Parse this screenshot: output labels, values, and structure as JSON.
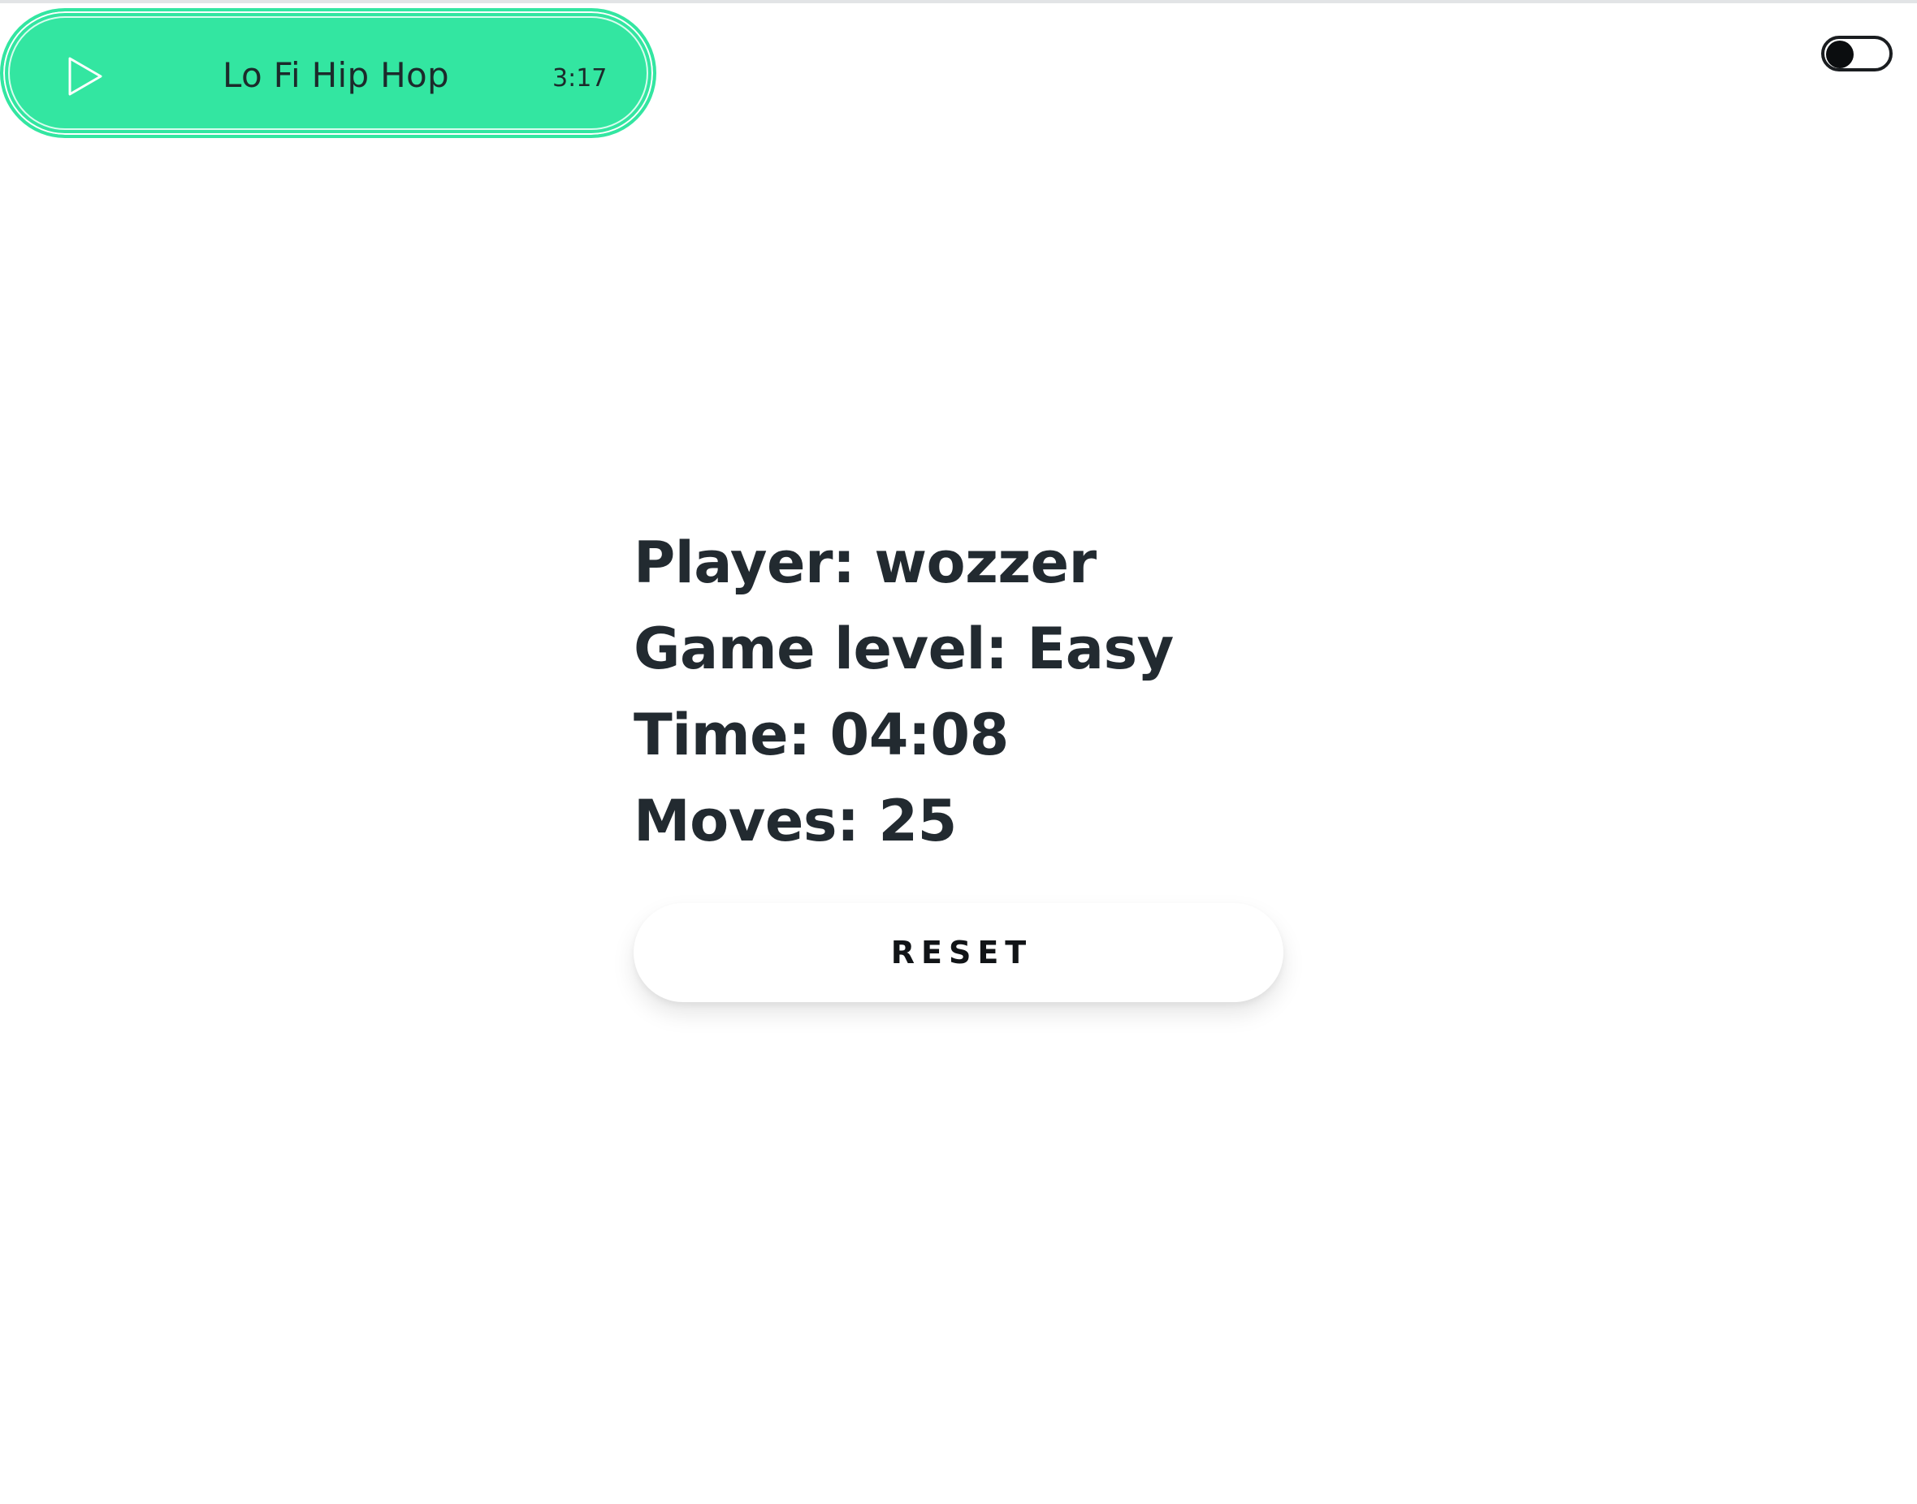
{
  "music_player": {
    "track_title": "Lo Fi Hip Hop",
    "track_duration": "3:17",
    "play_icon": "play-icon",
    "accent_color": "#33e6a1"
  },
  "theme_toggle": {
    "state": "off",
    "icon": "toggle-switch"
  },
  "stats": {
    "player": "Player: wozzer",
    "game_level": "Game level: Easy",
    "time": "Time: 04:08",
    "moves": "Moves: 25"
  },
  "actions": {
    "reset_label": "RESET"
  }
}
